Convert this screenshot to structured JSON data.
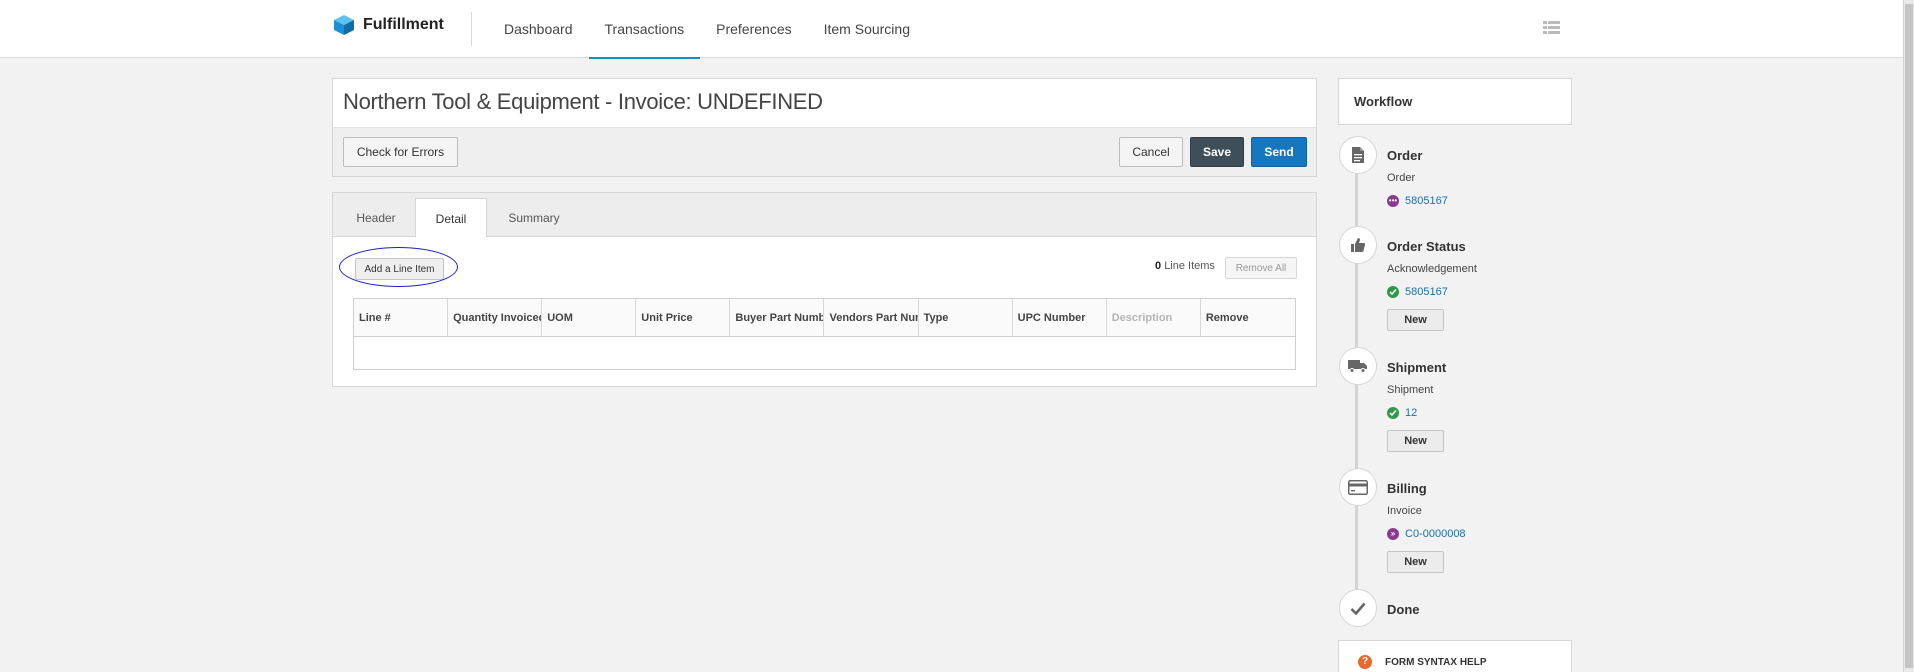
{
  "brand": {
    "name": "Fulfillment",
    "icon": "cube-icon"
  },
  "nav": {
    "items": [
      {
        "label": "Dashboard",
        "active": false
      },
      {
        "label": "Transactions",
        "active": true
      },
      {
        "label": "Preferences",
        "active": false
      },
      {
        "label": "Item Sourcing",
        "active": false
      }
    ],
    "menu_icon": "list-icon"
  },
  "document": {
    "title": "Northern Tool & Equipment - Invoice: UNDEFINED",
    "check_errors_label": "Check for Errors",
    "cancel_label": "Cancel",
    "save_label": "Save",
    "send_label": "Send"
  },
  "tabs": [
    {
      "label": "Header",
      "active": false
    },
    {
      "label": "Detail",
      "active": true
    },
    {
      "label": "Summary",
      "active": false
    }
  ],
  "detail": {
    "add_line_label": "Add a Line Item",
    "line_count": "0",
    "line_count_suffix": "Line Items",
    "remove_all_label": "Remove All",
    "columns": [
      "Line #",
      "Quantity Invoiced",
      "UOM",
      "Unit Price",
      "Buyer Part Number",
      "Vendors Part Number",
      "Type",
      "UPC Number",
      "Description",
      "Remove"
    ]
  },
  "workflow": {
    "title": "Workflow",
    "steps": [
      {
        "title": "Order",
        "sub": "Order",
        "link": "5805167",
        "status": "in-progress",
        "icon": "document-icon",
        "has_new": false
      },
      {
        "title": "Order Status",
        "sub": "Acknowledgement",
        "link": "5805167",
        "status": "complete",
        "icon": "thumbs-up-icon",
        "has_new": true,
        "new_label": "New"
      },
      {
        "title": "Shipment",
        "sub": "Shipment",
        "link": "12",
        "status": "complete",
        "icon": "truck-icon",
        "has_new": true,
        "new_label": "New"
      },
      {
        "title": "Billing",
        "sub": "Invoice",
        "link": "C0-0000008",
        "status": "forward",
        "icon": "credit-card-icon",
        "has_new": true,
        "new_label": "New"
      },
      {
        "title": "Done",
        "icon": "checkmark-icon"
      }
    ]
  },
  "help": {
    "label": "FORM SYNTAX HELP",
    "icon": "question-icon"
  },
  "colors": {
    "accent": "#1477c0",
    "dark": "#3e4f5a",
    "success": "#2e9a48",
    "pending": "#8b3b8f",
    "annotation": "#1a22c4"
  }
}
